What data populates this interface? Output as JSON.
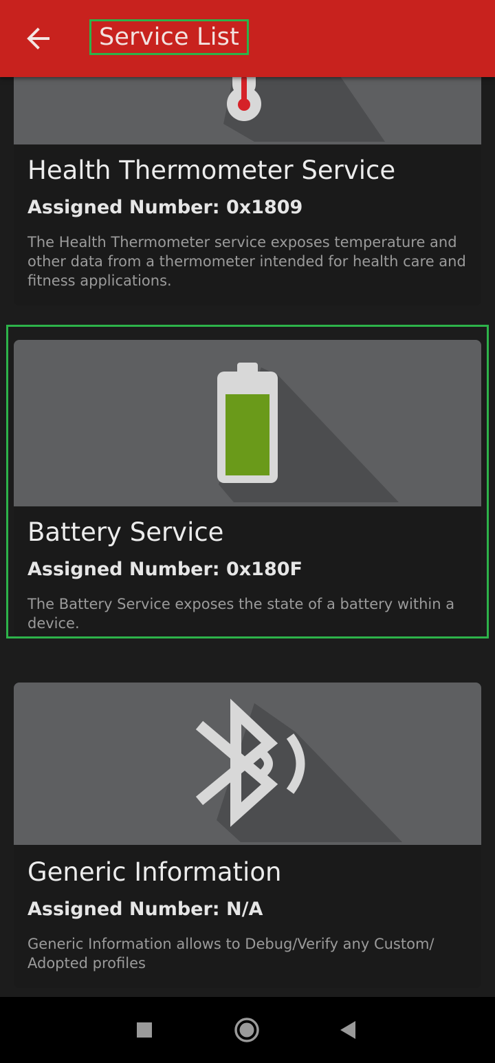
{
  "app_bar": {
    "title": "Service List",
    "back_icon": "arrow-left-icon",
    "color": "#c8221e"
  },
  "services": [
    {
      "title": "Health Thermometer Service",
      "assigned_number": "Assigned Number: 0x1809",
      "description": "The Health Thermometer service exposes temperature and other data from a thermometer intended for health care and fitness applications.",
      "icon": "thermometer-icon"
    },
    {
      "title": "Battery Service",
      "assigned_number": "Assigned Number: 0x180F",
      "description": "The Battery Service exposes the state of a battery within a device.",
      "icon": "battery-icon",
      "battery_color": "#6a9a1a"
    },
    {
      "title": "Generic Information",
      "assigned_number": "Assigned Number: N/A",
      "description": "Generic Information allows to Debug/Verify any Custom/ Adopted profiles",
      "icon": "bluetooth-icon"
    }
  ],
  "system_nav": {
    "recents_icon": "square-icon",
    "home_icon": "circle-icon",
    "back_icon": "triangle-back-icon"
  }
}
